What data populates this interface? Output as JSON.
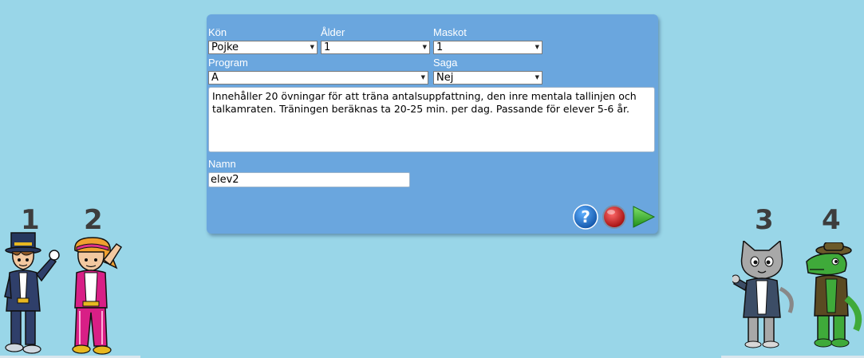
{
  "form": {
    "gender": {
      "label": "Kön",
      "value": "Pojke"
    },
    "age": {
      "label": "Ålder",
      "value": "1"
    },
    "mascot": {
      "label": "Maskot",
      "value": "1"
    },
    "program": {
      "label": "Program",
      "value": "A"
    },
    "story": {
      "label": "Saga",
      "value": "Nej"
    },
    "description": "Innehåller 20 övningar för att träna antalsuppfattning, den inre mentala tallinjen och talkamraten. Träningen beräknas ta 20-25 min. per dag. Passande för elever 5-6 år.",
    "name": {
      "label": "Namn",
      "value": "elev2"
    }
  },
  "buttons": {
    "help": "question-icon",
    "record": "record-icon",
    "start": "play-icon",
    "help_glyph": "?"
  },
  "mascots": [
    {
      "number": "1",
      "name": "boy-magician"
    },
    {
      "number": "2",
      "name": "girl-pink"
    },
    {
      "number": "3",
      "name": "cat"
    },
    {
      "number": "4",
      "name": "dinosaur"
    }
  ],
  "colors": {
    "background": "#99d6e8",
    "panel": "#6aa6de",
    "help": "#1e6fc4",
    "record": "#d01818",
    "play": "#3cb22c"
  }
}
